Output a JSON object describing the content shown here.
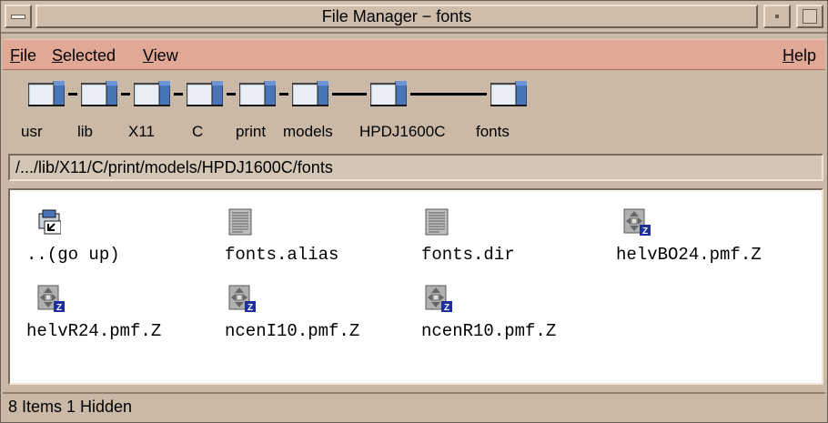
{
  "window": {
    "title": "File Manager − fonts"
  },
  "menubar": {
    "file": {
      "mnemonic": "F",
      "rest": "ile"
    },
    "selected": {
      "mnemonic": "S",
      "rest": "elected"
    },
    "view": {
      "mnemonic": "V",
      "rest": "iew"
    },
    "help": {
      "mnemonic": "H",
      "rest": "elp"
    }
  },
  "iconic_path": [
    {
      "label": "usr"
    },
    {
      "label": "lib"
    },
    {
      "label": "X11"
    },
    {
      "label": "C"
    },
    {
      "label": "print"
    },
    {
      "label": "models"
    },
    {
      "label": "HPDJ1600C"
    },
    {
      "label": "fonts"
    }
  ],
  "path_field": {
    "value": "/.../lib/X11/C/print/models/HPDJ1600C/fonts"
  },
  "files": [
    {
      "name": "..(go up)",
      "icon": "go-up-folder-icon"
    },
    {
      "name": "fonts.alias",
      "icon": "text-document-icon"
    },
    {
      "name": "fonts.dir",
      "icon": "text-document-icon"
    },
    {
      "name": "helvBO24.pmf.Z",
      "icon": "compressed-file-icon"
    },
    {
      "name": "helvR24.pmf.Z",
      "icon": "compressed-file-icon"
    },
    {
      "name": "ncenI10.pmf.Z",
      "icon": "compressed-file-icon"
    },
    {
      "name": "ncenR10.pmf.Z",
      "icon": "compressed-file-icon"
    }
  ],
  "status": {
    "text": "8 Items 1 Hidden"
  },
  "colors": {
    "menubar": "#e2a896",
    "frame": "#c9b9a6",
    "folder": "#4a74b8"
  }
}
